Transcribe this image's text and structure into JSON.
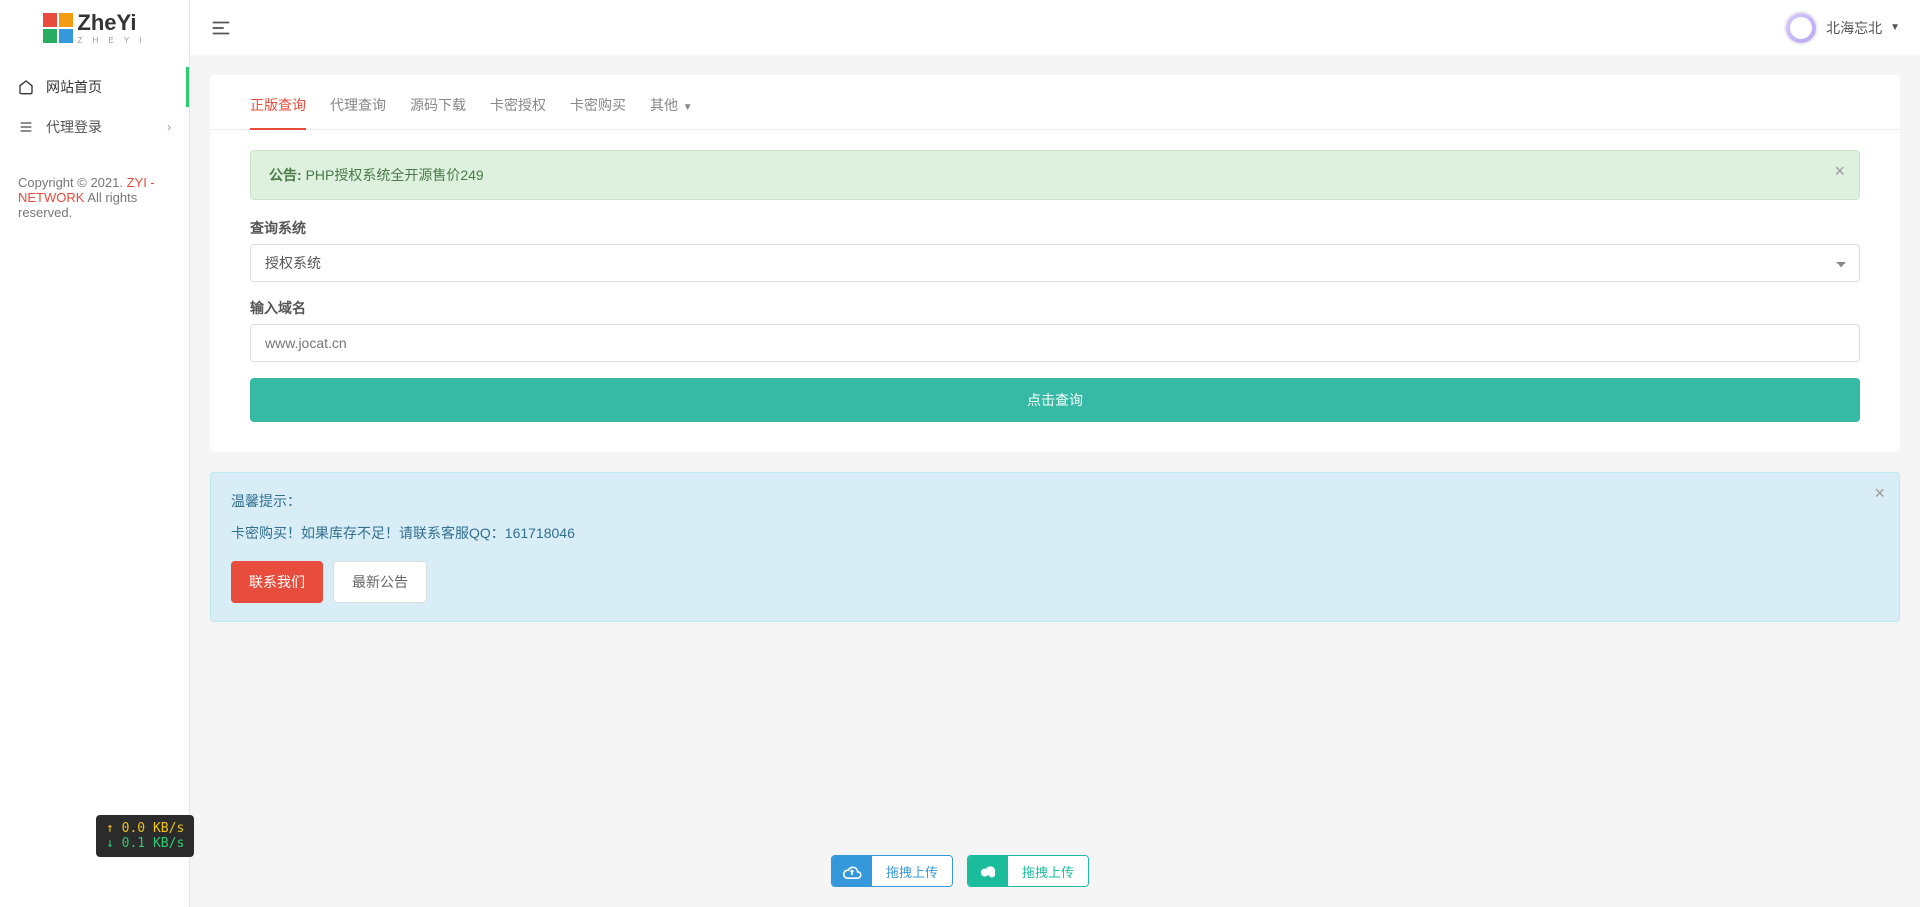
{
  "logo": {
    "text": "ZheYi",
    "sub": "Z H E Y I"
  },
  "sidebar": {
    "items": [
      {
        "label": "网站首页"
      },
      {
        "label": "代理登录"
      }
    ],
    "footer": {
      "copyright_prefix": "Copyright © 2021. ",
      "link": "ZYI - NETWORK",
      "copyright_suffix": " All rights reserved."
    }
  },
  "user": {
    "name": "北海忘北"
  },
  "tabs": [
    {
      "label": "正版查询"
    },
    {
      "label": "代理查询"
    },
    {
      "label": "源码下载"
    },
    {
      "label": "卡密授权"
    },
    {
      "label": "卡密购买"
    },
    {
      "label": "其他"
    }
  ],
  "notice": {
    "prefix": "公告: ",
    "text": "PHP授权系统全开源售价249"
  },
  "form": {
    "system_label": "查询系统",
    "system_value": "授权系统",
    "domain_label": "输入域名",
    "domain_placeholder": "www.jocat.cn",
    "submit": "点击查询"
  },
  "tip": {
    "title": "温馨提示：",
    "body": "卡密购买！如果库存不足！请联系客服QQ：161718046",
    "contact_btn": "联系我们",
    "news_btn": "最新公告"
  },
  "netspeed": {
    "up": "0.0 KB/s",
    "down": "0.1 KB/s"
  },
  "upload": {
    "label1": "拖拽上传",
    "label2": "拖拽上传"
  }
}
